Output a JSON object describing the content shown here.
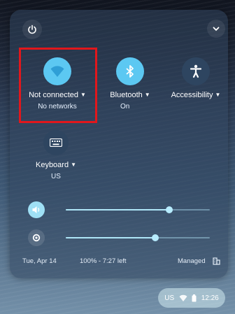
{
  "tiles": {
    "network": {
      "label": "Not connected",
      "sub": "No networks",
      "icon": "wifi-icon",
      "color": "#5cc8f2"
    },
    "bluetooth": {
      "label": "Bluetooth",
      "sub": "On",
      "icon": "bluetooth-icon",
      "color": "#5cc8f2"
    },
    "accessibility": {
      "label": "Accessibility",
      "icon": "accessibility-icon",
      "color": "#2e4560"
    },
    "keyboard": {
      "label": "Keyboard",
      "sub": "US",
      "icon": "keyboard-icon",
      "color": "#2e4560"
    }
  },
  "sliders": {
    "volume": {
      "icon": "volume-icon",
      "level": 0.72
    },
    "brightness": {
      "icon": "brightness-icon",
      "level": 0.62
    }
  },
  "footer": {
    "date": "Tue, Apr 14",
    "battery": "100% - 7:27 left",
    "managed": "Managed"
  },
  "tray": {
    "keyboard_layout": "US",
    "time": "12:26"
  },
  "colors": {
    "highlight": "#e1171c",
    "accent": "#5cc8f2"
  }
}
